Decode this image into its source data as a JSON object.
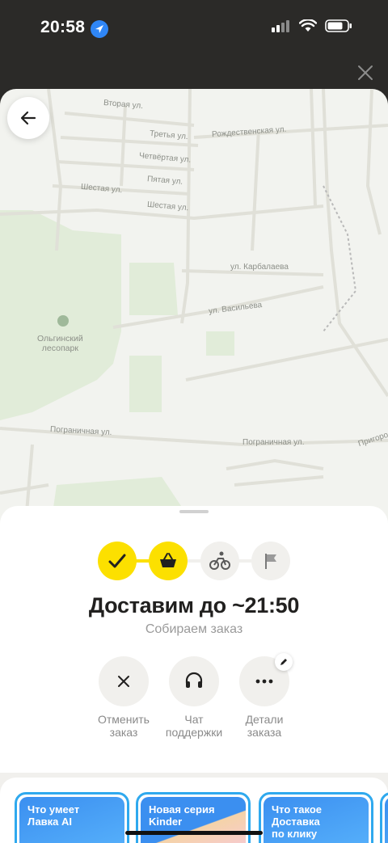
{
  "status_bar": {
    "time": "20:58"
  },
  "map": {
    "labels": {
      "street1": "Вторая ул.",
      "street2": "Третья ул.",
      "street3": "Четвёртая ул.",
      "street4": "Пятая ул.",
      "street5": "Шестая ул.",
      "street6": "Шестая ул.",
      "street7": "Рождественская ул.",
      "street8": "ул. Карбалаева",
      "street9": "ул. Васильева",
      "street10": "Пограничная ул.",
      "street11": "Пограничная ул.",
      "street12": "Пригородная",
      "park": "Ольгинский\nлесопарк"
    }
  },
  "order": {
    "title": "Доставим до ~21:50",
    "subtitle": "Собираем заказ",
    "steps": [
      "check",
      "basket",
      "courier",
      "flag"
    ],
    "accent": "#fce000"
  },
  "actions": [
    {
      "label": "Отменить\nзаказ",
      "icon": "close-icon"
    },
    {
      "label": "Чат\nподдержки",
      "icon": "headset-icon"
    },
    {
      "label": "Детали\nзаказа",
      "icon": "more-icon"
    }
  ],
  "stories": [
    {
      "text": "Что умеет\nЛавка AI"
    },
    {
      "text": "Новая серия\nKinder"
    },
    {
      "text": "Что такое\nДоставка\nпо клику"
    }
  ]
}
